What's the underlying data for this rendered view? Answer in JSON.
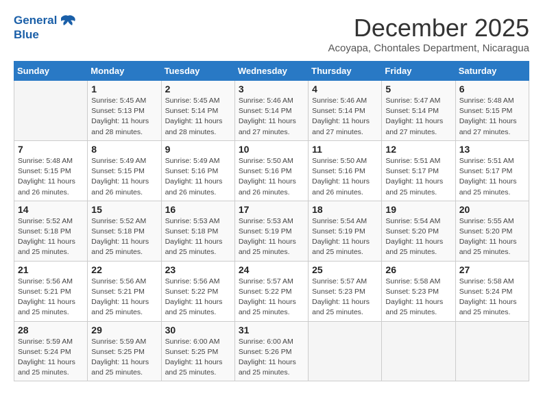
{
  "logo": {
    "line1": "General",
    "line2": "Blue"
  },
  "title": "December 2025",
  "subtitle": "Acoyapa, Chontales Department, Nicaragua",
  "days_of_week": [
    "Sunday",
    "Monday",
    "Tuesday",
    "Wednesday",
    "Thursday",
    "Friday",
    "Saturday"
  ],
  "weeks": [
    [
      {
        "day": "",
        "info": ""
      },
      {
        "day": "1",
        "info": "Sunrise: 5:45 AM\nSunset: 5:13 PM\nDaylight: 11 hours\nand 28 minutes."
      },
      {
        "day": "2",
        "info": "Sunrise: 5:45 AM\nSunset: 5:14 PM\nDaylight: 11 hours\nand 28 minutes."
      },
      {
        "day": "3",
        "info": "Sunrise: 5:46 AM\nSunset: 5:14 PM\nDaylight: 11 hours\nand 27 minutes."
      },
      {
        "day": "4",
        "info": "Sunrise: 5:46 AM\nSunset: 5:14 PM\nDaylight: 11 hours\nand 27 minutes."
      },
      {
        "day": "5",
        "info": "Sunrise: 5:47 AM\nSunset: 5:14 PM\nDaylight: 11 hours\nand 27 minutes."
      },
      {
        "day": "6",
        "info": "Sunrise: 5:48 AM\nSunset: 5:15 PM\nDaylight: 11 hours\nand 27 minutes."
      }
    ],
    [
      {
        "day": "7",
        "info": "Sunrise: 5:48 AM\nSunset: 5:15 PM\nDaylight: 11 hours\nand 26 minutes."
      },
      {
        "day": "8",
        "info": "Sunrise: 5:49 AM\nSunset: 5:15 PM\nDaylight: 11 hours\nand 26 minutes."
      },
      {
        "day": "9",
        "info": "Sunrise: 5:49 AM\nSunset: 5:16 PM\nDaylight: 11 hours\nand 26 minutes."
      },
      {
        "day": "10",
        "info": "Sunrise: 5:50 AM\nSunset: 5:16 PM\nDaylight: 11 hours\nand 26 minutes."
      },
      {
        "day": "11",
        "info": "Sunrise: 5:50 AM\nSunset: 5:16 PM\nDaylight: 11 hours\nand 26 minutes."
      },
      {
        "day": "12",
        "info": "Sunrise: 5:51 AM\nSunset: 5:17 PM\nDaylight: 11 hours\nand 25 minutes."
      },
      {
        "day": "13",
        "info": "Sunrise: 5:51 AM\nSunset: 5:17 PM\nDaylight: 11 hours\nand 25 minutes."
      }
    ],
    [
      {
        "day": "14",
        "info": "Sunrise: 5:52 AM\nSunset: 5:18 PM\nDaylight: 11 hours\nand 25 minutes."
      },
      {
        "day": "15",
        "info": "Sunrise: 5:52 AM\nSunset: 5:18 PM\nDaylight: 11 hours\nand 25 minutes."
      },
      {
        "day": "16",
        "info": "Sunrise: 5:53 AM\nSunset: 5:18 PM\nDaylight: 11 hours\nand 25 minutes."
      },
      {
        "day": "17",
        "info": "Sunrise: 5:53 AM\nSunset: 5:19 PM\nDaylight: 11 hours\nand 25 minutes."
      },
      {
        "day": "18",
        "info": "Sunrise: 5:54 AM\nSunset: 5:19 PM\nDaylight: 11 hours\nand 25 minutes."
      },
      {
        "day": "19",
        "info": "Sunrise: 5:54 AM\nSunset: 5:20 PM\nDaylight: 11 hours\nand 25 minutes."
      },
      {
        "day": "20",
        "info": "Sunrise: 5:55 AM\nSunset: 5:20 PM\nDaylight: 11 hours\nand 25 minutes."
      }
    ],
    [
      {
        "day": "21",
        "info": "Sunrise: 5:56 AM\nSunset: 5:21 PM\nDaylight: 11 hours\nand 25 minutes."
      },
      {
        "day": "22",
        "info": "Sunrise: 5:56 AM\nSunset: 5:21 PM\nDaylight: 11 hours\nand 25 minutes."
      },
      {
        "day": "23",
        "info": "Sunrise: 5:56 AM\nSunset: 5:22 PM\nDaylight: 11 hours\nand 25 minutes."
      },
      {
        "day": "24",
        "info": "Sunrise: 5:57 AM\nSunset: 5:22 PM\nDaylight: 11 hours\nand 25 minutes."
      },
      {
        "day": "25",
        "info": "Sunrise: 5:57 AM\nSunset: 5:23 PM\nDaylight: 11 hours\nand 25 minutes."
      },
      {
        "day": "26",
        "info": "Sunrise: 5:58 AM\nSunset: 5:23 PM\nDaylight: 11 hours\nand 25 minutes."
      },
      {
        "day": "27",
        "info": "Sunrise: 5:58 AM\nSunset: 5:24 PM\nDaylight: 11 hours\nand 25 minutes."
      }
    ],
    [
      {
        "day": "28",
        "info": "Sunrise: 5:59 AM\nSunset: 5:24 PM\nDaylight: 11 hours\nand 25 minutes."
      },
      {
        "day": "29",
        "info": "Sunrise: 5:59 AM\nSunset: 5:25 PM\nDaylight: 11 hours\nand 25 minutes."
      },
      {
        "day": "30",
        "info": "Sunrise: 6:00 AM\nSunset: 5:25 PM\nDaylight: 11 hours\nand 25 minutes."
      },
      {
        "day": "31",
        "info": "Sunrise: 6:00 AM\nSunset: 5:26 PM\nDaylight: 11 hours\nand 25 minutes."
      },
      {
        "day": "",
        "info": ""
      },
      {
        "day": "",
        "info": ""
      },
      {
        "day": "",
        "info": ""
      }
    ]
  ]
}
